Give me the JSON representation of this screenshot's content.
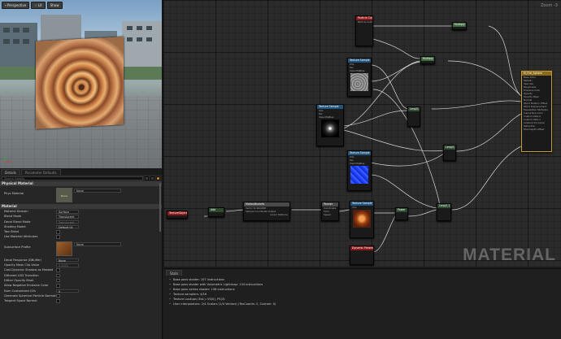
{
  "viewport": {
    "buttons": [
      "Perspective",
      "Lit",
      "Show"
    ]
  },
  "details": {
    "tabs": [
      "Details",
      "Parameter Defaults"
    ],
    "search_placeholder": "Search Details",
    "physical_section": "Physical Material",
    "phys_material_label": "Phys Material",
    "phys_material_value": "None",
    "thumb_none": "None",
    "material_section": "Material",
    "rows": [
      {
        "label": "Material Domain",
        "value": "Surface"
      },
      {
        "label": "Blend Mode",
        "value": "Translucent"
      },
      {
        "label": "Decal Blend Mode",
        "value": "Translucent",
        "disabled": true
      },
      {
        "label": "Shading Model",
        "value": "Default Lit"
      },
      {
        "label": "Two Sided",
        "checkbox": true
      },
      {
        "label": "Use Material Attributes",
        "checkbox": true
      }
    ],
    "subsurface_label": "Subsurface Profile",
    "subsurface_value": "None",
    "rows2": [
      {
        "label": "Decal Response (DBuffer)",
        "value": "None"
      },
      {
        "label": "Opacity Mask Clip Value",
        "value": "0.3333"
      },
      {
        "label": "Cast Dynamic Shadow as Masked",
        "checkbox": true
      },
      {
        "label": "Dithered LOD Transition",
        "checkbox": true
      },
      {
        "label": "Dither Opacity Mask",
        "checkbox": true
      },
      {
        "label": "Allow Negative Emissive Color",
        "checkbox": true
      },
      {
        "label": "Num Customized UVs",
        "value": "0"
      },
      {
        "label": "Generate Spherical Particle Normals",
        "checkbox": true
      },
      {
        "label": "Tangent Space Normal",
        "checkbox": true
      }
    ]
  },
  "graph": {
    "zoom": "Zoom -3",
    "watermark": "MATERIAL",
    "nodes": {
      "particle": {
        "title": "Particle Color",
        "sub": "Particle Color"
      },
      "multiply1": "Multiply",
      "multiply2": "Multiply",
      "lerp1": "Lerp(0,1)",
      "lerp2": "Lerp(0,1)",
      "lerp3": "Lerp(0,1)",
      "texsample": "Texture Sample",
      "texcoord": "TextureObject",
      "add": "Add",
      "power": "Power",
      "dynamic": "Dynamic Parameter",
      "output": "M_Fire_Sphere",
      "panner": "Panner",
      "param": "TextureObject",
      "tex_pins": [
        "UVs",
        "Tex",
        "View MipBias"
      ],
      "tex_out": [
        "RGB",
        "R",
        "G",
        "B",
        "A",
        "RGBA"
      ],
      "output_pins": [
        "Base Color",
        "Metallic",
        "Specular",
        "Roughness",
        "Emissive Color",
        "Opacity",
        "Opacity Mask",
        "Normal",
        "World Position Offset",
        "World Displacement",
        "Tessellation Multiplier",
        "Subsurface Color",
        "Custom Data 0",
        "Custom Data 1",
        "Ambient Occlusion",
        "Refraction",
        "Pixel Depth Offset"
      ],
      "panner_pins": [
        "Coordinate",
        "Time",
        "Speed"
      ],
      "motion": "MotionBlurInfo",
      "motion_pins": [
        "Vector to WA/ORD",
        "Sample Coordinate Output",
        "Linear Distance"
      ]
    }
  },
  "stats": {
    "tab": "Stats",
    "lines": [
      "Base pass shader: 107 instructions",
      "Base pass shader with Volumetric Lightmap: 134 instructions",
      "Base pass vertex shader: 138 instructions",
      "Texture samplers: 4/16",
      "Texture Lookups (Est.): VS(0), PS(3)",
      "User interpolators: 2/4 Scalars (1/4 Vectors) (TexCoords: 2, Custom: 0)"
    ]
  },
  "colors": {
    "accent": "#d98c1a",
    "node_red": "#8a1a1a",
    "node_blue": "#23547a"
  }
}
